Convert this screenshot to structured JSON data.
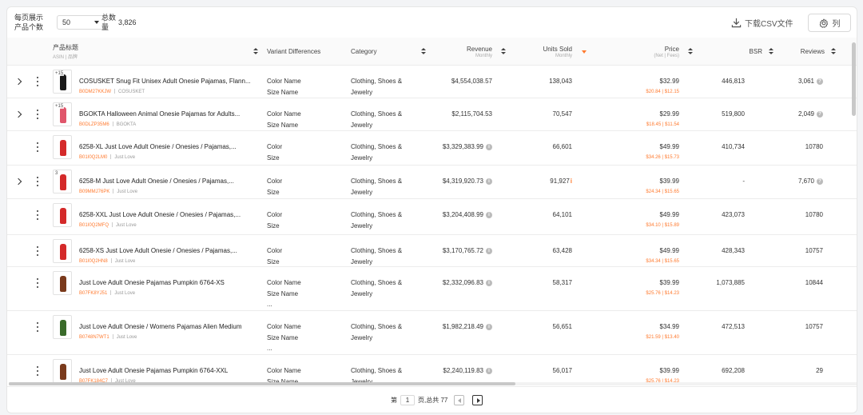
{
  "toolbar": {
    "per_page_label": "每页展示产品个数",
    "per_page_value": "50",
    "total_label": "总数量",
    "total_value": "3,826",
    "csv_label": "下载CSV文件",
    "columns_label": "列"
  },
  "columns": {
    "product_title": "产品标题",
    "product_sub": "ASIN | 品牌",
    "variant": "Variant Differences",
    "category": "Category",
    "revenue": "Revenue",
    "revenue_sub": "Monthly",
    "units": "Units Sold",
    "units_sub": "Monthly",
    "price": "Price",
    "price_sub": "(Net | Fees)",
    "bsr": "BSR",
    "reviews": "Reviews"
  },
  "rows": [
    {
      "expandable": true,
      "badge": "+15",
      "color": "#1a1a1a",
      "title": "COSUSKET Snug Fit Unisex Adult Onesie Pajamas, Flann...",
      "asin": "B0DM27KKJW",
      "brand": "COSUSKET",
      "v1": "Color Name",
      "v2": "Size Name",
      "v3": "",
      "cat1": "Clothing, Shoes &",
      "cat2": "Jewelry",
      "revenue": "$4,554,038.57",
      "rev_info": false,
      "units": "138,043",
      "units_warn": false,
      "price": "$32.99",
      "fees": "$20.84 | $12.15",
      "bsr": "446,813",
      "reviews": "3,061",
      "rev_icon": true
    },
    {
      "expandable": true,
      "badge": "+15",
      "color": "#e0566b",
      "title": "BGOKTA Halloween Animal Onesie Pajamas for Adults...",
      "asin": "B0DLZP35M6",
      "brand": "BGOKTA",
      "v1": "Color Name",
      "v2": "Size Name",
      "v3": "",
      "cat1": "Clothing, Shoes &",
      "cat2": "Jewelry",
      "revenue": "$2,115,704.53",
      "rev_info": false,
      "units": "70,547",
      "units_warn": false,
      "price": "$29.99",
      "fees": "$18.45 | $11.54",
      "bsr": "519,800",
      "reviews": "2,049",
      "rev_icon": true
    },
    {
      "expandable": false,
      "badge": "",
      "color": "#d42a2a",
      "title": "6258-XL Just Love Adult Onesie / Onesies / Pajamas,...",
      "asin": "B01I0Q2LM0",
      "brand": "Just Love",
      "v1": "Color",
      "v2": "Size",
      "v3": "",
      "cat1": "Clothing, Shoes &",
      "cat2": "Jewelry",
      "revenue": "$3,329,383.99",
      "rev_info": true,
      "units": "66,601",
      "units_warn": false,
      "price": "$49.99",
      "fees": "$34.26 | $15.73",
      "bsr": "410,734",
      "reviews": "10780",
      "rev_icon": false
    },
    {
      "expandable": true,
      "badge": "3",
      "color": "#d42a2a",
      "title": "6258-M Just Love Adult Onesie / Onesies / Pajamas,...",
      "asin": "B09MMJ76PK",
      "brand": "Just Love",
      "v1": "Color",
      "v2": "Size",
      "v3": "",
      "cat1": "Clothing, Shoes &",
      "cat2": "Jewelry",
      "revenue": "$4,319,920.73",
      "rev_info": true,
      "units": "91,927",
      "units_warn": true,
      "price": "$39.99",
      "fees": "$24.34 | $15.65",
      "bsr": "-",
      "reviews": "7,670",
      "rev_icon": true
    },
    {
      "expandable": false,
      "badge": "",
      "color": "#d42a2a",
      "title": "6258-XXL Just Love Adult Onesie / Onesies / Pajamas,...",
      "asin": "B01I0Q2MFQ",
      "brand": "Just Love",
      "v1": "Color",
      "v2": "Size",
      "v3": "",
      "cat1": "Clothing, Shoes &",
      "cat2": "Jewelry",
      "revenue": "$3,204,408.99",
      "rev_info": true,
      "units": "64,101",
      "units_warn": false,
      "price": "$49.99",
      "fees": "$34.10 | $15.89",
      "bsr": "423,073",
      "reviews": "10780",
      "rev_icon": false
    },
    {
      "expandable": false,
      "badge": "",
      "color": "#d42a2a",
      "title": "6258-XS Just Love Adult Onesie / Onesies / Pajamas,...",
      "asin": "B01I0Q2HN8",
      "brand": "Just Love",
      "v1": "Color",
      "v2": "Size",
      "v3": "",
      "cat1": "Clothing, Shoes &",
      "cat2": "Jewelry",
      "revenue": "$3,170,765.72",
      "rev_info": true,
      "units": "63,428",
      "units_warn": false,
      "price": "$49.99",
      "fees": "$34.34 | $15.65",
      "bsr": "428,343",
      "reviews": "10757",
      "rev_icon": false
    },
    {
      "expandable": false,
      "badge": "",
      "color": "#7a3a1c",
      "title": "Just Love Adult Onesie Pajamas Pumpkin 6764-XS",
      "asin": "B07FK8YJ51",
      "brand": "Just Love",
      "v1": "Color Name",
      "v2": "Size Name",
      "v3": "...",
      "cat1": "Clothing, Shoes &",
      "cat2": "Jewelry",
      "revenue": "$2,332,096.83",
      "rev_info": true,
      "units": "58,317",
      "units_warn": false,
      "price": "$39.99",
      "fees": "$25.76 | $14.23",
      "bsr": "1,073,885",
      "reviews": "10844",
      "rev_icon": false
    },
    {
      "expandable": false,
      "badge": "",
      "color": "#3a6b2a",
      "title": "Just Love Adult Onesie / Womens Pajamas Alien Medium",
      "asin": "B0748N7WT1",
      "brand": "Just Love",
      "v1": "Color Name",
      "v2": "Size Name",
      "v3": "...",
      "cat1": "Clothing, Shoes &",
      "cat2": "Jewelry",
      "revenue": "$1,982,218.49",
      "rev_info": true,
      "units": "56,651",
      "units_warn": false,
      "price": "$34.99",
      "fees": "$21.59 | $13.40",
      "bsr": "472,513",
      "reviews": "10757",
      "rev_icon": false
    },
    {
      "expandable": false,
      "badge": "",
      "color": "#7a3a1c",
      "title": "Just Love Adult Onesie Pajamas Pumpkin 6764-XXL",
      "asin": "B07FK184C7",
      "brand": "Just Love",
      "v1": "Color Name",
      "v2": "Size Name",
      "v3": "",
      "cat1": "Clothing, Shoes &",
      "cat2": "Jewelry",
      "revenue": "$2,240,119.83",
      "rev_info": true,
      "units": "56,017",
      "units_warn": false,
      "price": "$39.99",
      "fees": "$25.76 | $14.23",
      "bsr": "692,208",
      "reviews": "29",
      "rev_icon": false
    }
  ],
  "pager": {
    "prefix": "第",
    "page": "1",
    "suffix": "页,总共 77"
  }
}
